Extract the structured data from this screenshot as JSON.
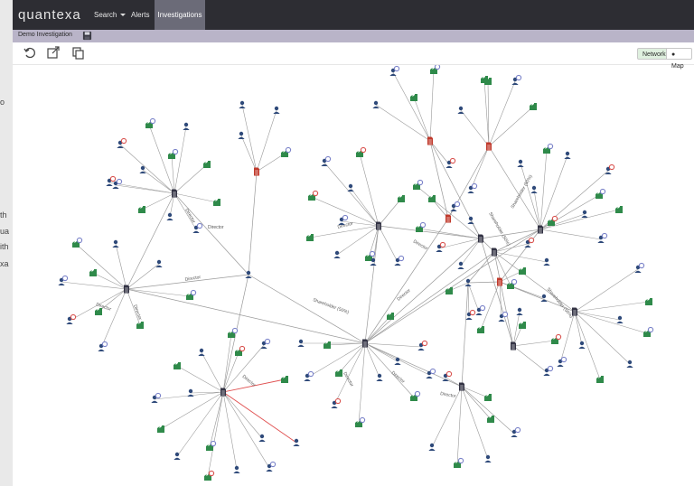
{
  "nav": {
    "logo": "quantexa",
    "search": "Search",
    "alerts": "Alerts",
    "investigations": "Investigations"
  },
  "subbar": {
    "title": "Demo Investigation"
  },
  "view_toggle": {
    "network": "Network",
    "map": "Map"
  },
  "left_fragments": [
    "o",
    "th",
    "ua",
    "ith",
    "xa"
  ],
  "edge_labels": [
    "Director",
    "Director",
    "Director",
    "Director",
    "Director",
    "Director",
    "Director",
    "Director",
    "Director",
    "Director",
    "Director",
    "Director",
    "Shareholder (50%)",
    "Shareholder (50%)",
    "Shareholder (50%)",
    "Shareholder (50%)"
  ],
  "colors": {
    "nav_bg": "#2d2d33",
    "subbar_bg": "#b9b4c8",
    "person_icon": "#2f4a7a",
    "company_icon": "#2f8a4a",
    "document_icon": "#333344",
    "alert_document": "#c0392b",
    "red_badge": "#d9534f",
    "blue_badge": "#7b83c9",
    "edge": "#9a9a9a",
    "highlight_edge": "#e05050"
  }
}
